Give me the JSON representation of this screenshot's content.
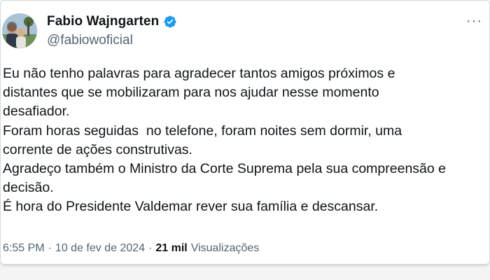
{
  "author": {
    "display_name": "Fabio Wajngarten",
    "handle": "@fabiowoficial",
    "verified": true
  },
  "post": {
    "lines": [
      "Eu não tenho palavras para agradecer tantos amigos próximos e",
      "distantes que se mobilizaram para nos ajudar nesse momento",
      "desafiador.",
      "Foram horas seguidas  no telefone, foram noites sem dormir, uma",
      "corrente de ações construtivas.",
      "Agradeço também o Ministro da Corte Suprema pela sua compreensão e",
      "decisão.",
      "É hora do Presidente Valdemar rever sua família e descansar."
    ]
  },
  "meta": {
    "time": "6:55 PM",
    "separator": "·",
    "date": "10 de fev de 2024",
    "views_count": "21 mil",
    "views_label": "Visualizações"
  },
  "menu": {
    "more_label": "···"
  },
  "colors": {
    "text": "#0f1419",
    "secondary": "#536471",
    "verified": "#1d9bf0"
  }
}
